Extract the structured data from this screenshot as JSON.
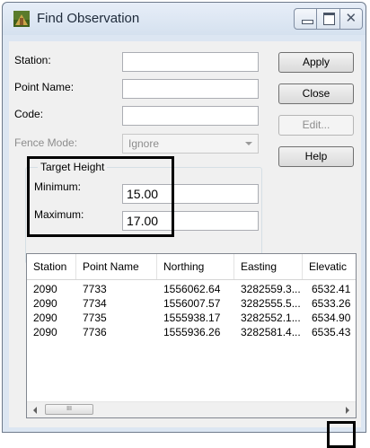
{
  "window": {
    "title": "Find Observation",
    "close_glyph": "✕"
  },
  "form": {
    "station_label": "Station:",
    "station_value": "",
    "point_name_label": "Point Name:",
    "point_name_value": "",
    "code_label": "Code:",
    "code_value": "",
    "fence_mode_label": "Fence Mode:",
    "fence_mode_value": "Ignore"
  },
  "target_height": {
    "label": "Target Height",
    "minimum_label": "Minimum:",
    "minimum_value": "15.00",
    "maximum_label": "Maximum:",
    "maximum_value": "17.00"
  },
  "buttons": {
    "apply": "Apply",
    "close": "Close",
    "edit": "Edit...",
    "help": "Help"
  },
  "table": {
    "columns": [
      "Station",
      "Point Name",
      "Northing",
      "Easting",
      "Elevatic"
    ],
    "rows": [
      [
        "2090",
        "7733",
        "1556062.64",
        "3282559.3...",
        "6532.41"
      ],
      [
        "2090",
        "7734",
        "1556007.57",
        "3282555.5...",
        "6533.26"
      ],
      [
        "2090",
        "7735",
        "1555938.17",
        "3282552.1...",
        "6534.90"
      ],
      [
        "2090",
        "7736",
        "1555936.26",
        "3282581.4...",
        "6535.43"
      ]
    ],
    "scroll_thumb_grip": "III"
  },
  "colors": {
    "window_frame": "#dce6f2",
    "client": "#f0f0f0",
    "highlight": "#000000"
  }
}
